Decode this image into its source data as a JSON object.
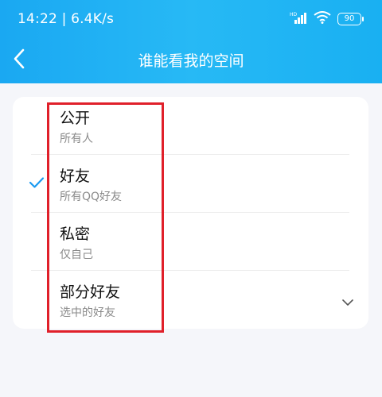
{
  "status": {
    "time_speed": "14:22 | 6.4K/s",
    "battery": "90"
  },
  "nav": {
    "title": "谁能看我的空间"
  },
  "options": [
    {
      "title": "公开",
      "subtitle": "所有人",
      "selected": false
    },
    {
      "title": "好友",
      "subtitle": "所有QQ好友",
      "selected": true
    },
    {
      "title": "私密",
      "subtitle": "仅自己",
      "selected": false
    },
    {
      "title": "部分好友",
      "subtitle": "选中的好友",
      "selected": false,
      "expandable": true
    }
  ],
  "colors": {
    "header_gradient_start": "#1aa8f2",
    "header_gradient_end": "#19b0f2",
    "check": "#1a9af0",
    "highlight": "#e0202a",
    "background": "#f5f6fa"
  }
}
